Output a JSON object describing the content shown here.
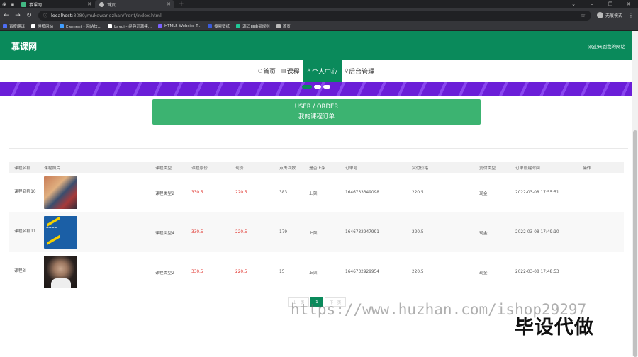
{
  "browser": {
    "tabs": [
      {
        "title": "慕课网",
        "icon_color": "#42b883",
        "active": false
      },
      {
        "title": "首页",
        "icon_color": "#bbbbbb",
        "active": true
      }
    ],
    "url_host": "localhost",
    "url_rest": ":8080/mukewangzhan/front/index.html",
    "profile_label": "无痕模式",
    "bookmarks": [
      {
        "label": "百度翻译",
        "color": "#4e6ef2"
      },
      {
        "label": "搜狐网站",
        "color": "#ffffff"
      },
      {
        "label": "Element - 网站快...",
        "color": "#409eff"
      },
      {
        "label": "Layui - 经典开源模...",
        "color": "#ffffff"
      },
      {
        "label": "HTML5 Website T...",
        "color": "#7b61ff"
      },
      {
        "label": "搜索壁纸",
        "color": "#3b5bdb"
      },
      {
        "label": "源码自由买规则",
        "color": "#20c997"
      },
      {
        "label": "首页",
        "color": "#bbbbbb"
      }
    ]
  },
  "site": {
    "logo": "慕课网",
    "welcome": "欢迎来到我的网站",
    "accent": "#0a8a5b",
    "nav": [
      {
        "icon": "○",
        "label": "首页",
        "active": false
      },
      {
        "icon": "▤",
        "label": "课程",
        "active": false
      },
      {
        "icon": "♙",
        "label": "个人中心",
        "active": true
      },
      {
        "icon": "⚲",
        "label": "后台管理",
        "active": false
      }
    ]
  },
  "section": {
    "title_en": "USER / ORDER",
    "title_cn": "我的课程订单"
  },
  "table": {
    "headers": [
      "课程名称",
      "课程照片",
      "课程类型",
      "课程原价",
      "现价",
      "点击次数",
      "是否上架",
      "订单号",
      "实付价格",
      "支付类型",
      "订单创建时间",
      "操作"
    ],
    "rows": [
      {
        "name": "课程名称10",
        "type": "课程类型2",
        "orig": "330.5",
        "price": "220.5",
        "clicks": "383",
        "shelf": "上架",
        "order": "1646733349098",
        "paid": "220.5",
        "paytype": "现金",
        "time": "2022-03-08 17:55:51",
        "op": ""
      },
      {
        "name": "课程名称11",
        "type": "课程类型4",
        "orig": "330.5",
        "price": "220.5",
        "clicks": "179",
        "shelf": "上架",
        "order": "1646732947991",
        "paid": "220.5",
        "paytype": "现金",
        "time": "2022-03-08 17:49:10",
        "op": ""
      },
      {
        "name": "课程3l",
        "type": "课程类型2",
        "orig": "330.5",
        "price": "220.5",
        "clicks": "15",
        "shelf": "上架",
        "order": "1646732929954",
        "paid": "220.5",
        "paytype": "现金",
        "time": "2022-03-08 17:48:53",
        "op": ""
      }
    ]
  },
  "pagination": {
    "prev": "上一页",
    "current": "1",
    "next": "下一页"
  },
  "watermark": {
    "url": "https://www.huzhan.com/ishop29297",
    "text": "毕设代做"
  }
}
